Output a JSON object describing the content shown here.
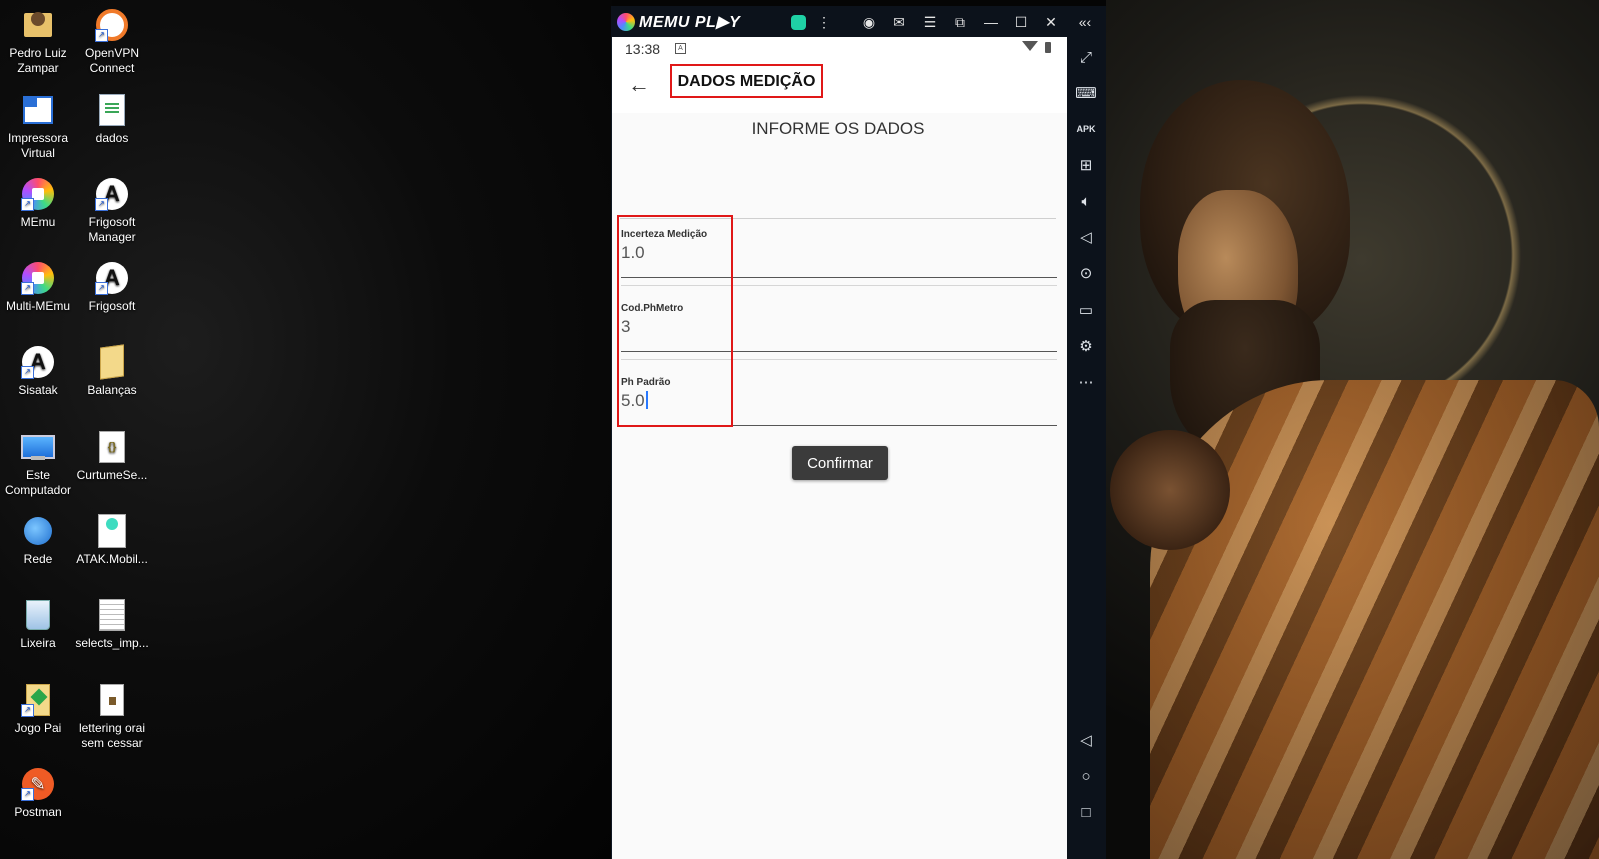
{
  "desktop": {
    "icons": [
      {
        "label": "Pedro Luiz\nZampar"
      },
      {
        "label": "OpenVPN\nConnect"
      },
      {
        "label": "Impressora\nVirtual"
      },
      {
        "label": "dados"
      },
      {
        "label": "MEmu"
      },
      {
        "label": "Frigosoft\nManager"
      },
      {
        "label": "Multi-MEmu"
      },
      {
        "label": "Frigosoft"
      },
      {
        "label": "Sisatak"
      },
      {
        "label": "Balanças"
      },
      {
        "label": "Este\nComputador"
      },
      {
        "label": "CurtumeSe..."
      },
      {
        "label": "Rede"
      },
      {
        "label": "ATAK.Mobil..."
      },
      {
        "label": "Lixeira"
      },
      {
        "label": "selects_imp..."
      },
      {
        "label": "Jogo Pai"
      },
      {
        "label": "lettering orai\nsem cessar"
      },
      {
        "label": "Postman"
      }
    ]
  },
  "emulator": {
    "brand": "MEMU PL▶Y",
    "titlebar_icons": [
      "app-badge-icon",
      "more-vert-icon",
      "account-icon",
      "mail-icon",
      "menu-icon",
      "screenshot-icon",
      "minimize-icon",
      "maximize-icon",
      "close-icon",
      "collapse-icon"
    ],
    "sidebar_icons": [
      "fullscreen-icon",
      "keyboard-icon",
      "apk-icon",
      "add-app-icon",
      "volume-up-icon",
      "volume-down-icon",
      "location-icon",
      "folder-icon",
      "settings-icon",
      "more-icon",
      "android-back-icon",
      "android-home-icon",
      "android-recents-icon"
    ]
  },
  "android": {
    "status": {
      "time": "13:38"
    },
    "appbar": {
      "title": "DADOS MEDIÇÃO"
    },
    "form": {
      "subtitle": "INFORME OS DADOS",
      "fields": [
        {
          "label": "Incerteza Medição",
          "value": "1.0"
        },
        {
          "label": "Cod.PhMetro",
          "value": "3"
        },
        {
          "label": "Ph Padrão",
          "value": "5.0"
        }
      ],
      "confirm_label": "Confirmar"
    }
  },
  "colors": {
    "highlight": "#e01818",
    "button_bg": "#3b3b3b",
    "emulator_chrome": "#0c121b"
  }
}
